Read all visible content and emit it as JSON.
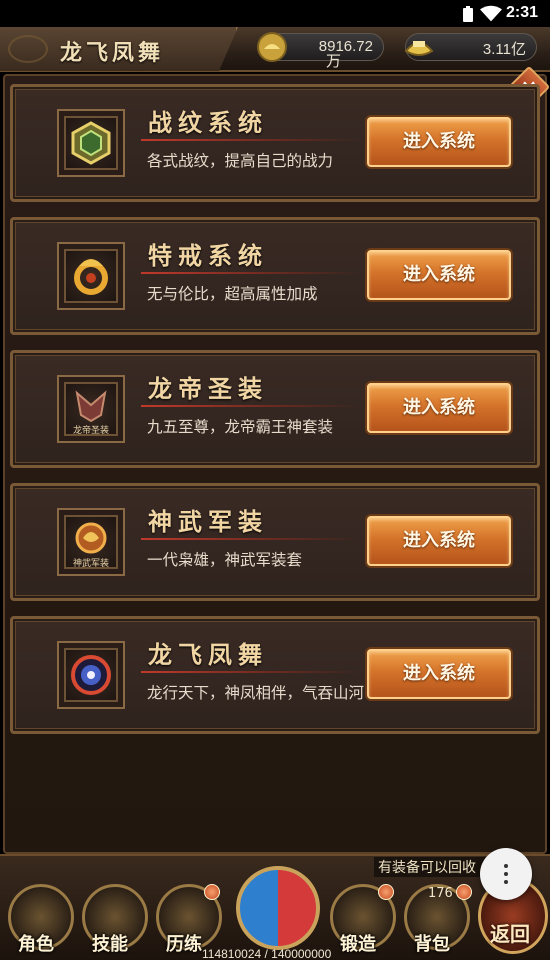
{
  "status_bar": {
    "time": "2:31"
  },
  "header": {
    "title": "龙飞凤舞",
    "resource_1": {
      "value": "8916.72",
      "unit": "万",
      "icon": "gold-ingot-icon"
    },
    "resource_2": {
      "value": "3.11亿",
      "icon": "silver-ingot-icon"
    }
  },
  "systems": [
    {
      "title": "战纹系统",
      "desc": "各式战纹，提高自己的战力",
      "button": "进入系统",
      "icon": "rune-shield-icon"
    },
    {
      "title": "特戒系统",
      "desc": "无与伦比，超高属性加成",
      "button": "进入系统",
      "icon": "golden-dragon-ring-icon"
    },
    {
      "title": "龙帝圣装",
      "desc": "九五至尊，龙帝霸王神套装",
      "button": "进入系统",
      "icon": "dragon-emperor-armor-icon",
      "icon_text": "龙帝圣装"
    },
    {
      "title": "神武军装",
      "desc": "一代枭雄，神武军装套",
      "button": "进入系统",
      "icon": "divine-armor-icon",
      "icon_text": "神武军装"
    },
    {
      "title": "龙飞凤舞",
      "desc": "龙行天下，神凤相伴，气吞山河",
      "button": "进入系统",
      "icon": "phoenix-orb-icon"
    }
  ],
  "bottom_bar": {
    "notice": "有装备可以回收",
    "items": [
      {
        "label": "角色",
        "icon": "character-icon"
      },
      {
        "label": "技能",
        "icon": "skill-book-icon"
      },
      {
        "label": "历练",
        "icon": "crossed-swords-icon"
      },
      {
        "label": "锻造",
        "icon": "forge-anvil-icon"
      },
      {
        "label": "背包",
        "icon": "bag-icon"
      }
    ],
    "bag_count": "176",
    "exp": "114810024 / 140000000",
    "return_label": "返回"
  }
}
